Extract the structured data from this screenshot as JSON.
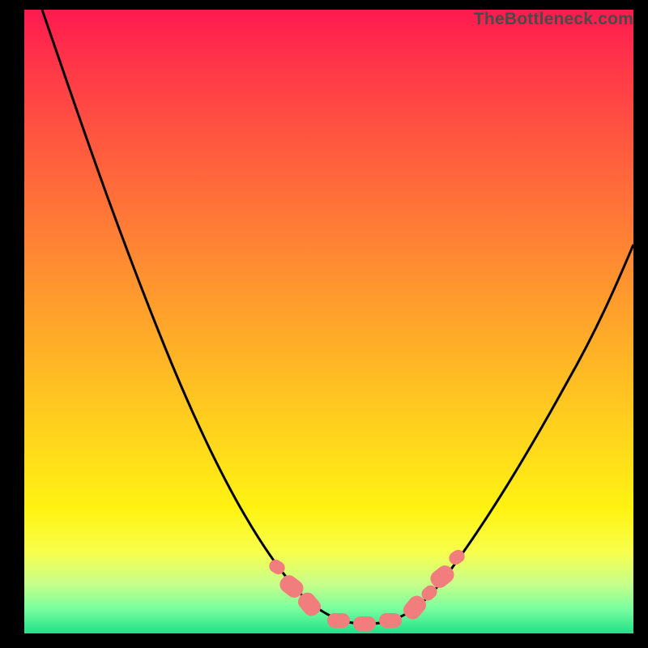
{
  "watermark": {
    "text": "TheBottleneck.com"
  },
  "colors": {
    "frame": "#000000",
    "gradient_top": "#ff1a4f",
    "gradient_mid": "#ffd91b",
    "gradient_bottom": "#21e08a",
    "curve": "#000000",
    "bead": "#f27d7d",
    "label": "#4a4a4a"
  },
  "chart_data": {
    "type": "line",
    "title": "",
    "xlabel": "",
    "ylabel": "",
    "x_range": [
      0,
      100
    ],
    "y_range": [
      0,
      100
    ],
    "legend": false,
    "grid": false,
    "background": "vertical-gradient-heat",
    "series": [
      {
        "name": "bottleneck-curve",
        "x": [
          3,
          7,
          12,
          18,
          24,
          30,
          36,
          42,
          46,
          50,
          54,
          58,
          62,
          66,
          72,
          80,
          90,
          100
        ],
        "y": [
          100,
          89,
          77,
          65,
          53,
          41,
          29,
          17,
          8,
          3,
          1,
          2,
          6,
          12,
          22,
          35,
          52,
          70
        ]
      }
    ],
    "markers": [
      {
        "x": 41,
        "y": 15
      },
      {
        "x": 43,
        "y": 10
      },
      {
        "x": 45,
        "y": 6
      },
      {
        "x": 50,
        "y": 2
      },
      {
        "x": 55,
        "y": 2
      },
      {
        "x": 59,
        "y": 4
      },
      {
        "x": 62,
        "y": 8
      },
      {
        "x": 64,
        "y": 12
      },
      {
        "x": 66,
        "y": 16
      }
    ],
    "annotations": []
  }
}
